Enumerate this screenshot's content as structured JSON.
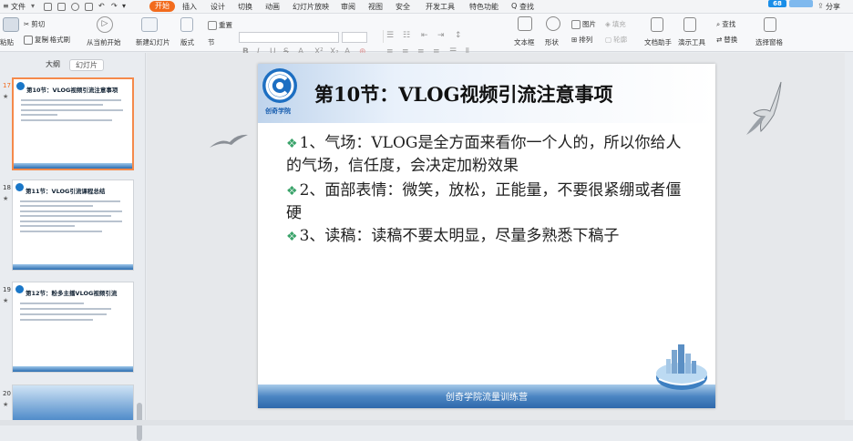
{
  "menubar": {
    "file": "文件",
    "tabs": [
      "开始",
      "插入",
      "设计",
      "切换",
      "动画",
      "幻灯片放映",
      "审阅",
      "视图",
      "安全",
      "开发工具",
      "特色功能"
    ],
    "active_tab": "开始",
    "search": "查找",
    "share": "分享",
    "badge": "68"
  },
  "ribbon": {
    "paste": "粘贴",
    "cut": "剪切",
    "copy": "复制",
    "format_painter": "格式刷",
    "from_current": "从当前开始",
    "new_slide": "新建幻灯片",
    "layout": "版式",
    "section": "节",
    "reset": "重置",
    "font_name": "",
    "font_size": "",
    "textbox": "文本框",
    "shape": "形状",
    "arrange": "排列",
    "outline": "轮廓",
    "picture": "图片",
    "fill": "填充",
    "doc_helper": "文档助手",
    "present_tools": "演示工具",
    "find": "查找",
    "replace": "替换",
    "select_pane": "选择窗格"
  },
  "panel": {
    "tab_outline": "大纲",
    "tab_slides": "幻灯片",
    "slides": [
      {
        "num": "17",
        "title": "第10节：VLOG视频引流注意事项",
        "selected": true
      },
      {
        "num": "18",
        "title": "第11节：VLOG引流课程总结",
        "selected": false
      },
      {
        "num": "19",
        "title": "第12节：粉多主播VLOG视频引流",
        "selected": false
      },
      {
        "num": "20",
        "title": "",
        "selected": false
      }
    ]
  },
  "slide": {
    "logo_text": "创奇学院",
    "title": "第10节：VLOG视频引流注意事项",
    "bullets": [
      "1、气场：VLOG是全方面来看你一个人的，所以你给人的气场，信任度，会决定加粉效果",
      "2、面部表情：微笑，放松，正能量，不要很紧绷或者僵硬",
      "3、读稿：读稿不要太明显，尽量多熟悉下稿子"
    ],
    "footer": "创奇学院流量训练营"
  },
  "colors": {
    "accent": "#f26b1d",
    "bullet_marker": "#3aa36a",
    "footer_band": "#2e68ab"
  }
}
